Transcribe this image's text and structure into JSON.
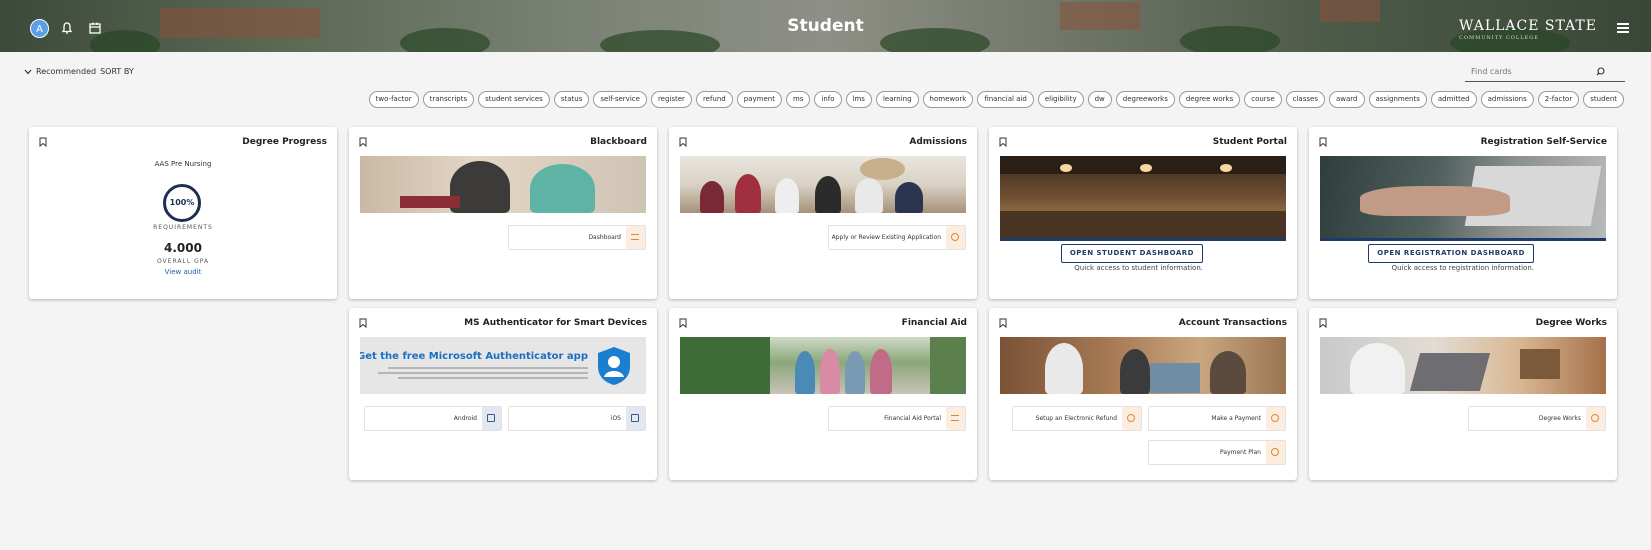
{
  "header": {
    "title": "Student",
    "avatar_initial": "A",
    "brand_name": "WALLACE STATE",
    "brand_sub": "COMMUNITY COLLEGE"
  },
  "toolbar": {
    "sort_label": "SORT BY",
    "sort_value": "Recommended",
    "search_placeholder": "Find cards"
  },
  "tags": [
    "student",
    "2-factor",
    "admissions",
    "admitted",
    "assignments",
    "award",
    "classes",
    "course",
    "degree works",
    "degreeworks",
    "dw",
    "eligibility",
    "financial aid",
    "homework",
    "learning",
    "lms",
    "info",
    "ms",
    "payment",
    "refund",
    "register",
    "self-service",
    "status",
    "student services",
    "transcripts",
    "two-factor"
  ],
  "cards": {
    "registration": {
      "title": "Registration Self-Service",
      "button": "OPEN REGISTRATION DASHBOARD",
      "subtitle": "Quick access to registration information."
    },
    "portal": {
      "title": "Student Portal",
      "button": "OPEN STUDENT DASHBOARD",
      "subtitle": "Quick access to student information."
    },
    "admissions": {
      "title": "Admissions",
      "links": [
        "Apply or Review Existing Application"
      ]
    },
    "blackboard": {
      "title": "Blackboard",
      "links": [
        "Dashboard"
      ]
    },
    "degree_progress": {
      "title": "Degree Progress",
      "program": "AAS Pre Nursing",
      "percent": "100%",
      "requirements_label": "REQUIREMENTS",
      "gpa": "4.000",
      "gpa_label": "OVERALL GPA",
      "link": "View audit"
    },
    "degree_works": {
      "title": "Degree Works",
      "links": [
        "Degree Works"
      ]
    },
    "account": {
      "title": "Account Transactions",
      "links": [
        "Make a Payment",
        "Setup an Electronic Refund",
        "Payment Plan"
      ]
    },
    "financial": {
      "title": "Financial Aid",
      "links": [
        "Financial Aid Portal"
      ]
    },
    "ms_auth": {
      "title": "MS Authenticator for Smart Devices",
      "banner_title": "Tip: Get the free Microsoft Authenticator app",
      "links": [
        "iOS",
        "Android"
      ]
    }
  }
}
